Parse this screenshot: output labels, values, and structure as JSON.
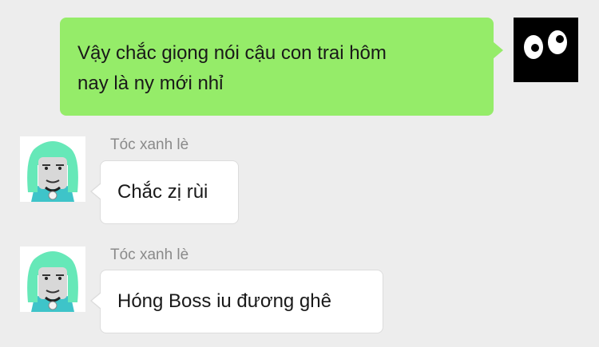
{
  "messages": [
    {
      "direction": "outgoing",
      "lines": [
        "Vậy chắc giọng nói cậu con trai hôm",
        "nay là ny mới nhỉ"
      ]
    },
    {
      "direction": "incoming",
      "sender": "Tóc xanh lè",
      "text": "Chắc zị rùi"
    },
    {
      "direction": "incoming",
      "sender": "Tóc xanh lè",
      "text": "Hóng Boss iu đương ghê"
    }
  ],
  "colors": {
    "background": "#ededed",
    "outgoing_bubble": "#95ec69",
    "incoming_bubble": "#ffffff",
    "sender_name": "#8a8a8a",
    "friend_avatar_hair": "#66e8b8"
  },
  "icons": {
    "self_avatar": "black-square-with-cartoon-eyes",
    "friend_avatar": "green-haired-meme-face"
  }
}
